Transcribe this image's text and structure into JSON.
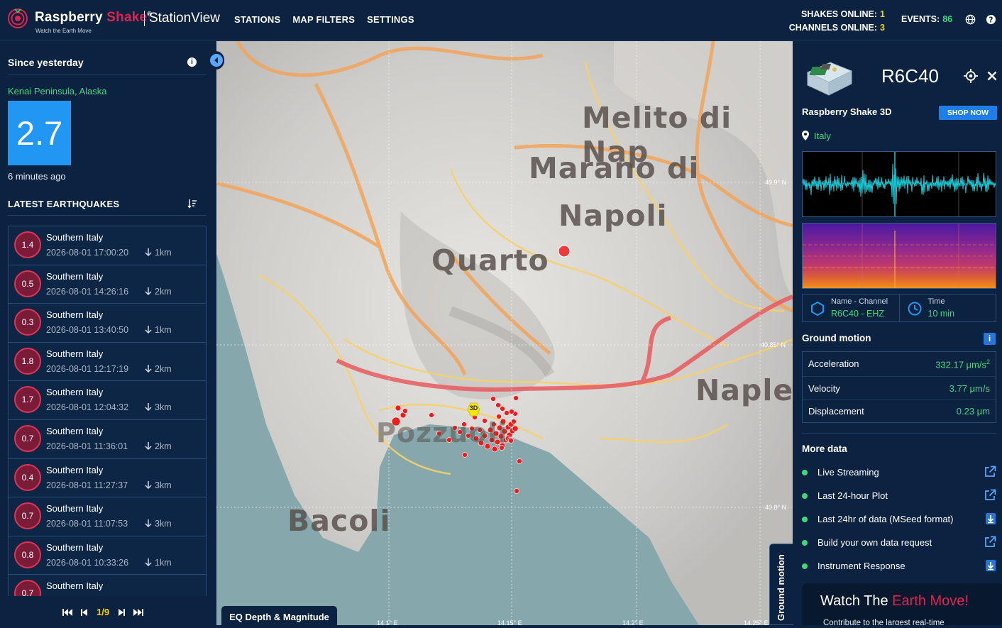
{
  "header": {
    "brand_part1": "Raspberry ",
    "brand_part2": "Shake",
    "brand_reg": "®",
    "tagline": "Watch the Earth Move",
    "app_name": "StationView",
    "nav": [
      "STATIONS",
      "MAP FILTERS",
      "SETTINGS"
    ],
    "shakes_online_label": "SHAKES ONLINE:",
    "shakes_online": "1",
    "channels_online_label": "CHANNELS ONLINE:",
    "channels_online": "3",
    "events_label": "EVENTS:",
    "events": "86",
    "icons": [
      "globe-icon",
      "help-icon"
    ]
  },
  "left_panel": {
    "since_label": "Since yesterday",
    "featured": {
      "region": "Kenai Peninsula, Alaska",
      "magnitude": "2.7",
      "ago": "6 minutes ago"
    },
    "list_title": "LATEST EARTHQUAKES",
    "earthquakes": [
      {
        "mag": "1.4",
        "place": "Southern Italy",
        "time": "2026-08-01 17:00:20",
        "depth": "1km"
      },
      {
        "mag": "0.5",
        "place": "Southern Italy",
        "time": "2026-08-01 14:26:16",
        "depth": "2km"
      },
      {
        "mag": "0.3",
        "place": "Southern Italy",
        "time": "2026-08-01 13:40:50",
        "depth": "1km"
      },
      {
        "mag": "1.8",
        "place": "Southern Italy",
        "time": "2026-08-01 12:17:19",
        "depth": "2km"
      },
      {
        "mag": "1.7",
        "place": "Southern Italy",
        "time": "2026-08-01 12:04:32",
        "depth": "3km"
      },
      {
        "mag": "0.7",
        "place": "Southern Italy",
        "time": "2026-08-01 11:36:01",
        "depth": "2km"
      },
      {
        "mag": "0.4",
        "place": "Southern Italy",
        "time": "2026-08-01 11:27:37",
        "depth": "3km"
      },
      {
        "mag": "0.7",
        "place": "Southern Italy",
        "time": "2026-08-01 11:07:53",
        "depth": "3km"
      },
      {
        "mag": "0.8",
        "place": "Southern Italy",
        "time": "2026-08-01 10:33:26",
        "depth": "1km"
      },
      {
        "mag": "0.7",
        "place": "Southern Italy",
        "time": "",
        "depth": ""
      }
    ],
    "pager": {
      "page": "1/9"
    }
  },
  "map": {
    "places": [
      "Melito di Nap",
      "Marano di",
      "Napoli",
      "Quarto",
      "Naple",
      "Pozzuoli",
      "Bacoli"
    ],
    "lat_labels": [
      "40.9° N",
      "40.85° N",
      "40.8° N"
    ],
    "lon_labels": [
      "14.1° E",
      "14.15° E",
      "14.2° E",
      "14.25° E"
    ],
    "station_marker": "3D",
    "legend_tab": "EQ Depth & Magnitude",
    "ground_motion_tab": "Ground motion",
    "colors": {
      "quake": "#ee1c1c",
      "station": "#f5e60d"
    }
  },
  "station": {
    "name": "R6C40",
    "device": "Raspberry Shake 3D",
    "shop_label": "SHOP NOW",
    "country": "Italy",
    "channel_label": "Name - Channel",
    "channel_value": "R6C40 - EHZ",
    "time_label": "Time",
    "time_value": "10 min",
    "ground_motion_title": "Ground motion",
    "ground_motion": [
      {
        "label": "Acceleration",
        "value": "332.17 μm/s",
        "sup": "2"
      },
      {
        "label": "Velocity",
        "value": "3.77 μm/s",
        "sup": ""
      },
      {
        "label": "Displacement",
        "value": "0.23 μm",
        "sup": ""
      }
    ],
    "more_title": "More data",
    "more_items": [
      {
        "label": "Live Streaming",
        "icon": "external-link-icon"
      },
      {
        "label": "Last 24-hour Plot",
        "icon": "external-link-icon"
      },
      {
        "label": "Last 24hr of data (MSeed format)",
        "icon": "download-icon"
      },
      {
        "label": "Build your own data request",
        "icon": "external-link-icon"
      },
      {
        "label": "Instrument Response",
        "icon": "download-icon"
      }
    ],
    "promo_title_1": "Watch The ",
    "promo_title_2": "Earth Move!",
    "promo_sub": "Contribute to the largest real-time"
  }
}
